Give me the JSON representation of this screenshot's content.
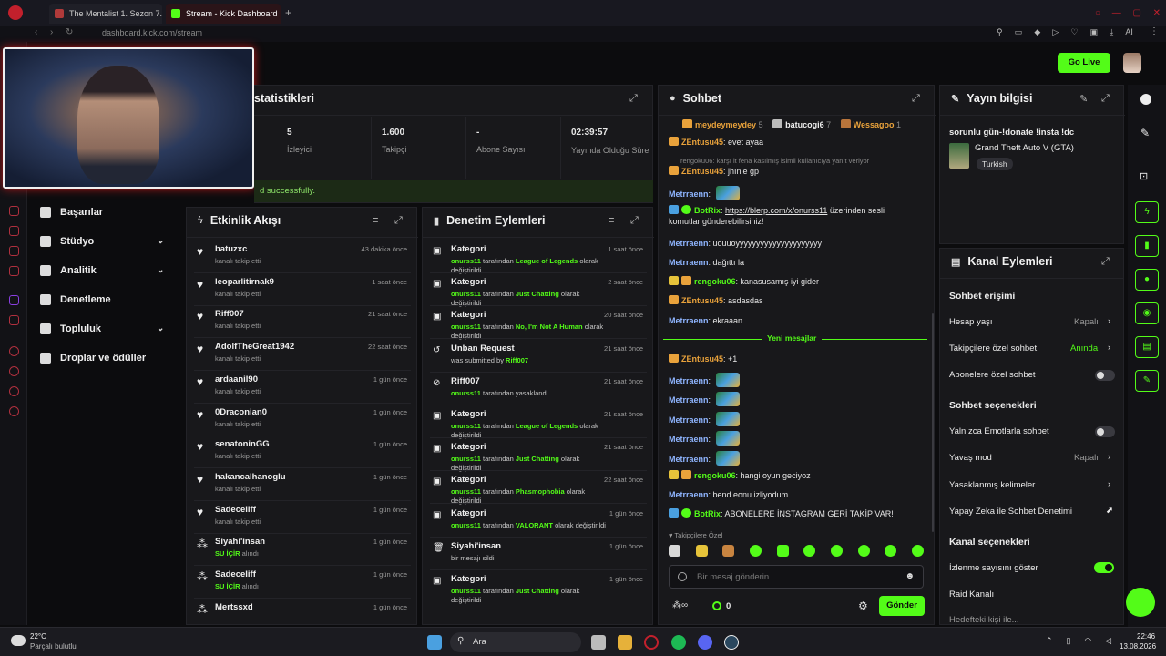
{
  "browser": {
    "tabs": [
      {
        "label": "The Mentalist 1. Sezon 7. B"
      },
      {
        "label": "Stream - Kick Dashboard"
      }
    ],
    "new_tab_label": "+",
    "url": "dashboard.kick.com/stream",
    "toolbar_ai": "AI"
  },
  "header": {
    "go_live": "Go Live"
  },
  "stats": {
    "title": "İstatistikleri",
    "title_visible": "statistikleri",
    "items": [
      {
        "value": "5",
        "label": "İzleyici"
      },
      {
        "value": "1.600",
        "label": "Takipçi"
      },
      {
        "value": "-",
        "label": "Abone Sayısı"
      },
      {
        "value": "02:39:57",
        "label": "Yayında Olduğu Süre"
      }
    ],
    "banner": "d successfully."
  },
  "sidenav": {
    "items": [
      {
        "label": "Başarılar"
      },
      {
        "label": "Stüdyo",
        "chevron": "⌄"
      },
      {
        "label": "Analitik",
        "chevron": "⌄"
      },
      {
        "label": "Denetleme"
      },
      {
        "label": "Topluluk",
        "chevron": "⌄"
      },
      {
        "label": "Droplar ve ödüller"
      }
    ]
  },
  "activity": {
    "title": "Etkinlik Akışı",
    "rows": [
      {
        "icon": "heart",
        "name": "batuzxc",
        "sub": "kanalı takip etti",
        "time": "43 dakika önce"
      },
      {
        "icon": "heart",
        "name": "leoparlitirnak9",
        "sub": "kanalı takip etti",
        "time": "1 saat önce"
      },
      {
        "icon": "heart",
        "name": "Riff007",
        "sub": "kanalı takip etti",
        "time": "21 saat önce"
      },
      {
        "icon": "heart",
        "name": "AdolfTheGreat1942",
        "sub": "kanalı takip etti",
        "time": "22 saat önce"
      },
      {
        "icon": "heart",
        "name": "ardaanil90",
        "sub": "kanalı takip etti",
        "time": "1 gün önce"
      },
      {
        "icon": "heart",
        "name": "0Draconian0",
        "sub": "kanalı takip etti",
        "time": "1 gün önce"
      },
      {
        "icon": "heart",
        "name": "senatoninGG",
        "sub": "kanalı takip etti",
        "time": "1 gün önce"
      },
      {
        "icon": "heart",
        "name": "hakancalhanoglu",
        "sub": "kanalı takip etti",
        "time": "1 gün önce"
      },
      {
        "icon": "heart",
        "name": "Sadeceliff",
        "sub": "kanalı takip etti",
        "time": "1 gün önce"
      },
      {
        "icon": "reward",
        "name": "Siyahi'insan",
        "sub_green": "SU İÇİR",
        "sub": " alındı",
        "time": "1 gün önce"
      },
      {
        "icon": "reward",
        "name": "Sadeceliff",
        "sub_green": "SU İÇİR",
        "sub": " alındı",
        "time": "1 gün önce"
      },
      {
        "icon": "reward",
        "name": "Mertssxd",
        "sub": "",
        "time": "1 gün önce"
      }
    ]
  },
  "moderation": {
    "title": "Denetim Eylemleri",
    "rows": [
      {
        "icon": "category",
        "name": "Kategori",
        "actor": "onurss11",
        "mid": " tarafından ",
        "target": "League of Legends",
        "end": " olarak değiştirildi",
        "time": "1 saat önce"
      },
      {
        "icon": "category",
        "name": "Kategori",
        "actor": "onurss11",
        "mid": " tarafından ",
        "target": "Just Chatting",
        "end": " olarak değiştirildi",
        "time": "2 saat önce"
      },
      {
        "icon": "category",
        "name": "Kategori",
        "actor": "onurss11",
        "mid": " tarafından ",
        "target": "No, I'm Not A Human",
        "end": " olarak değiştirildi",
        "time": "20 saat önce"
      },
      {
        "icon": "unban",
        "name": "Unban Request",
        "actor": "",
        "mid": "was submitted by ",
        "target": "Riff007",
        "end": "",
        "time": "21 saat önce"
      },
      {
        "icon": "ban",
        "name": "Riff007",
        "actor": "onurss11",
        "mid": " tarafından yasaklandı",
        "target": "",
        "end": "",
        "time": "21 saat önce"
      },
      {
        "icon": "category",
        "name": "Kategori",
        "actor": "onurss11",
        "mid": " tarafından ",
        "target": "League of Legends",
        "end": " olarak değiştirildi",
        "time": "21 saat önce"
      },
      {
        "icon": "category",
        "name": "Kategori",
        "actor": "onurss11",
        "mid": " tarafından ",
        "target": "Just Chatting",
        "end": " olarak değiştirildi",
        "time": "21 saat önce"
      },
      {
        "icon": "category",
        "name": "Kategori",
        "actor": "onurss11",
        "mid": " tarafından ",
        "target": "Phasmophobia",
        "end": " olarak değiştirildi",
        "time": "22 saat önce"
      },
      {
        "icon": "category",
        "name": "Kategori",
        "actor": "onurss11",
        "mid": " tarafından ",
        "target": "VALORANT",
        "end": " olarak değiştirildi",
        "time": "1 gün önce"
      },
      {
        "icon": "trash",
        "name": "Siyahi'insan",
        "actor": "",
        "mid": "bir mesajı sildi",
        "target": "",
        "end": "",
        "time": "1 gün önce"
      },
      {
        "icon": "category",
        "name": "Kategori",
        "actor": "onurss11",
        "mid": " tarafından ",
        "target": "Just Chatting",
        "end": " olarak değiştirildi",
        "time": "1 gün önce"
      }
    ]
  },
  "chat": {
    "title": "Sohbet",
    "leaders": [
      {
        "name": "meydeymeydey",
        "count": "5"
      },
      {
        "name": "batucogi6",
        "count": "7"
      },
      {
        "name": "Wessagoo",
        "count": "1"
      }
    ],
    "reply_note": "rengoku06: karşı it fena kasılmış isimli kullanıcıya yanıt veriyor",
    "new_messages": "Yeni mesajlar",
    "followers_only": "Takipçilere Özel",
    "input_placeholder": "Bir mesaj gönderin",
    "points": "0",
    "send": "Gönder",
    "colors": {
      "ZEntusu45": "#e9a23b",
      "Metrraenn": "#8fb5ff",
      "BotRix": "#53fc18",
      "rengoku06": "#53fc18"
    }
  },
  "stream_info": {
    "title": "Yayın bilgisi",
    "stream_title": "sorunlu gün-!donate !insta !dc",
    "game": "Grand Theft Auto V (GTA)",
    "language": "Turkish"
  },
  "channel_actions": {
    "title": "Kanal Eylemleri",
    "chat_access": "Sohbet erişimi",
    "account_age": "Hesap yaşı",
    "account_age_val": "Kapalı",
    "followers_chat": "Takipçilere özel sohbet",
    "followers_chat_val": "Anında",
    "subs_chat": "Abonelere özel sohbet",
    "chat_options": "Sohbet seçenekleri",
    "emotes_only": "Yalnızca Emotlarla sohbet",
    "slow_mode": "Yavaş mod",
    "slow_mode_val": "Kapalı",
    "banned_words": "Yasaklanmış kelimeler",
    "ai_moderation": "Yapay Zeka ile Sohbet Denetimi",
    "channel_options": "Kanal seçenekleri",
    "show_viewcount": "İzlenme sayısını göster",
    "raid": "Raid Kanalı",
    "raid_follow": "Hedefteki kişi ile..."
  },
  "taskbar": {
    "weather_temp": "22°C",
    "weather_desc": "Parçalı bulutlu",
    "search": "Ara",
    "time": "22:46",
    "date": "13.08.2026"
  },
  "accent": "#53fc18"
}
